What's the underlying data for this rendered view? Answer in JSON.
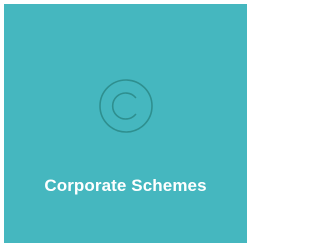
{
  "tile": {
    "label": "Corporate Schemes",
    "icon": "copyright-icon",
    "background_color": "#45b7bf",
    "icon_color": "#2e8f8f",
    "label_color": "#ffffff"
  }
}
